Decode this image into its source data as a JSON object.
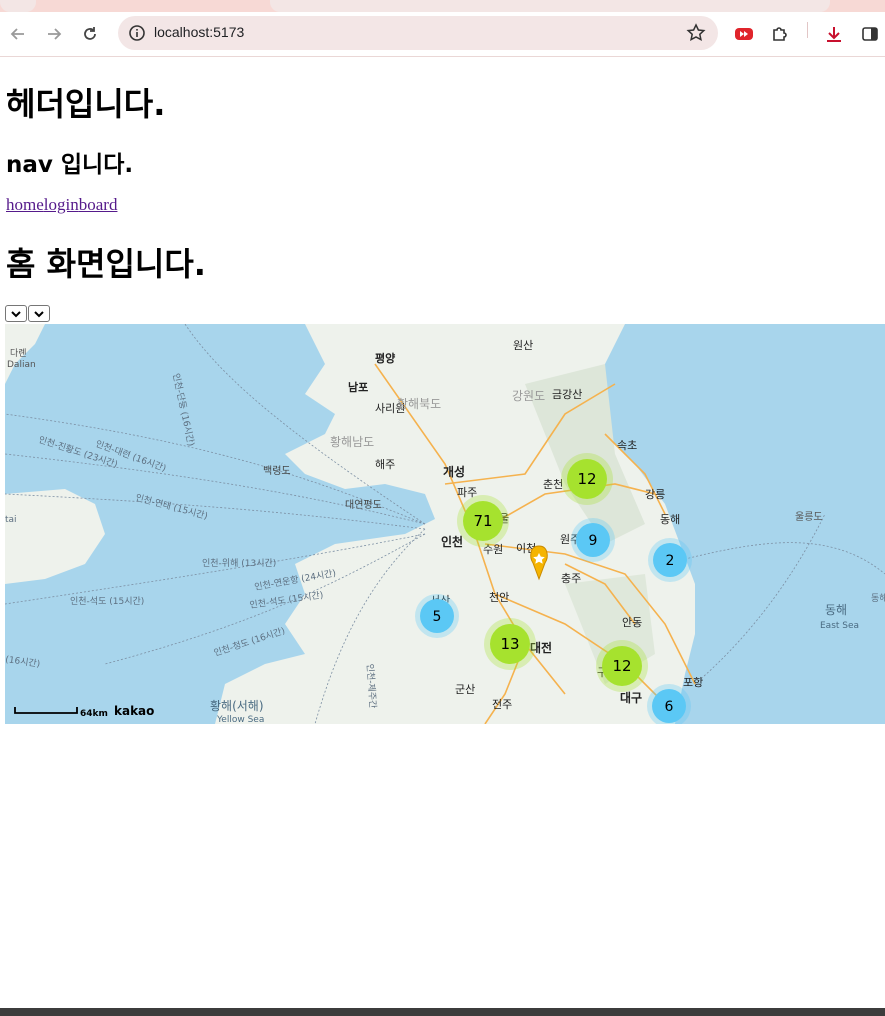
{
  "browser": {
    "url": "localhost:5173",
    "icons": [
      "back-icon",
      "forward-icon",
      "reload-icon",
      "info-icon",
      "star-icon",
      "youtube-extension-icon",
      "extensions-icon",
      "download-icon",
      "side-panel-icon"
    ]
  },
  "page": {
    "header": "헤더입니다.",
    "nav_title": "nav 입니다.",
    "links": [
      "home",
      "login",
      "board"
    ],
    "home_title": "홈 화면입니다."
  },
  "map": {
    "places": {
      "pyongyang": "평양",
      "nampo": "남포",
      "sariwon": "사리원",
      "haeju": "해주",
      "kaesong": "개성",
      "hwanghae_north": "황해북도",
      "hwanghae_south": "황해남도",
      "gangwon_n": "강원도",
      "geumgangsan": "금강산",
      "wonsan": "원산",
      "sokcho": "속초",
      "gangneung": "강릉",
      "donghae": "동해",
      "chuncheon": "춘천",
      "paju": "파주",
      "incheon": "인천",
      "suwon": "수원",
      "icheon": "이천",
      "wonju": "원주",
      "chungju": "충주",
      "cheonan": "천안",
      "daejeon": "대전",
      "andong": "안동",
      "gunsan": "군산",
      "jeonju": "전주",
      "daegu": "대구",
      "pohang": "포항",
      "seosan": "서산",
      "gumi": "구미",
      "baengnyeongdo": "백령도",
      "daeyeonpyeongdo": "대연평도",
      "ulleungdo": "울릉도",
      "dalian_ko": "다롄",
      "dalian_en": "Dalian",
      "east_sea_ko": "동해",
      "east_sea_en": "East Sea",
      "yellow_sea_ko": "황해(서해)",
      "yellow_sea_en": "Yellow Sea",
      "seoul_part": "울"
    },
    "routes": {
      "r1": "인천-단둥 (16시간)",
      "r2": "인천-대련 (16시간)",
      "r3": "인천-진황도 (23시간)",
      "r4": "인천-연태 (15시간)",
      "r5": "인천-위해 (13시간)",
      "r6": "인천-연운항 (24시간)",
      "r7": "인천-석도 (15시간)",
      "r8": "인천-석도 (15시간)",
      "r9": "인천-청도 (16시간)",
      "r10": "(16시간)",
      "r11": "인천-제주간",
      "r12": "동해",
      "r13": "tai"
    },
    "clusters": [
      {
        "id": "c1",
        "count": "12",
        "color": "#a6e22e"
      },
      {
        "id": "c2",
        "count": "71",
        "color": "#a6e22e"
      },
      {
        "id": "c3",
        "count": "9",
        "color": "#5bc8f5"
      },
      {
        "id": "c4",
        "count": "2",
        "color": "#5bc8f5"
      },
      {
        "id": "c5",
        "count": "5",
        "color": "#5bc8f5"
      },
      {
        "id": "c6",
        "count": "13",
        "color": "#a6e22e"
      },
      {
        "id": "c7",
        "count": "12",
        "color": "#a6e22e"
      },
      {
        "id": "c8",
        "count": "6",
        "color": "#5bc8f5"
      }
    ],
    "scale": "64km",
    "brand": "kakao"
  },
  "colors": {
    "sea": "#a8d5ec",
    "land": "#eef2ec",
    "road": "#f5b24e",
    "link": "#551a8b"
  }
}
